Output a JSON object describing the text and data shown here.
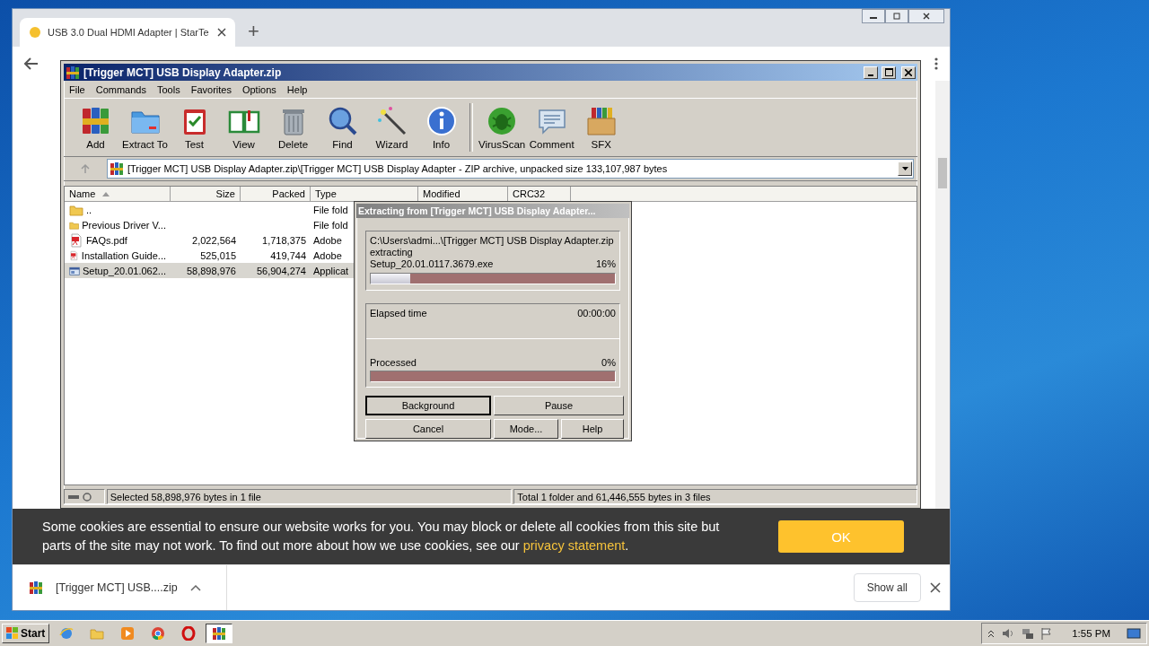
{
  "browser": {
    "tabs": [
      {
        "title": "USB 3.0 Dual HDMI Adapter | StarTe",
        "selected": true
      }
    ],
    "new_tab": "+",
    "cookie_banner": {
      "text": "Some cookies are essential to ensure our website works for you. You may block or delete all cookies from this site but parts of the site may not work. To find out more about how we use cookies, see our ",
      "link": "privacy statement",
      "end": ".",
      "button": "OK"
    },
    "download_shelf": {
      "file": "[Trigger MCT] USB....zip",
      "show_all": "Show all"
    }
  },
  "winrar": {
    "title": "[Trigger MCT] USB Display Adapter.zip",
    "menu": [
      "File",
      "Commands",
      "Tools",
      "Favorites",
      "Options",
      "Help"
    ],
    "toolbar_groups": [
      {
        "buttons": [
          "Add",
          "Extract To",
          "Test",
          "View",
          "Delete",
          "Find",
          "Wizard",
          "Info"
        ]
      },
      {
        "buttons": [
          "VirusScan",
          "Comment",
          "SFX"
        ]
      }
    ],
    "path": "[Trigger MCT] USB Display Adapter.zip\\[Trigger MCT] USB Display Adapter - ZIP archive, unpacked size 133,107,987 bytes",
    "columns": [
      "Name",
      "Size",
      "Packed",
      "Type",
      "Modified",
      "CRC32"
    ],
    "rows": [
      {
        "kind": "parent",
        "name": "..",
        "size": "",
        "packed": "",
        "type": "File fold",
        "selected": false
      },
      {
        "kind": "folder",
        "name": "Previous Driver V...",
        "size": "",
        "packed": "",
        "type": "File fold",
        "selected": false
      },
      {
        "kind": "pdf",
        "name": "FAQs.pdf",
        "size": "2,022,564",
        "packed": "1,718,375",
        "type": "Adobe",
        "selected": false
      },
      {
        "kind": "pdf",
        "name": "Installation Guide...",
        "size": "525,015",
        "packed": "419,744",
        "type": "Adobe",
        "selected": false
      },
      {
        "kind": "exe",
        "name": "Setup_20.01.062...",
        "size": "58,898,976",
        "packed": "56,904,274",
        "type": "Applicat",
        "selected": true
      }
    ],
    "status_left": "Selected 58,898,976 bytes in 1 file",
    "status_right": "Total 1 folder and 61,446,555 bytes in 3 files"
  },
  "dialog": {
    "title": "Extracting from [Trigger MCT] USB Display Adapter...",
    "archive": "C:\\Users\\admi...\\[Trigger MCT] USB Display Adapter.zip",
    "action": "extracting",
    "file": "Setup_20.01.0117.3679.exe",
    "file_percent": "16%",
    "file_progress": {
      "level": 0.16
    },
    "elapsed_label": "Elapsed time",
    "elapsed": "00:00:00",
    "processed_label": "Processed",
    "processed_percent": "0%",
    "processed_progress": {
      "level": 0
    },
    "buttons": [
      {
        "label": "Background",
        "default": true
      },
      {
        "label": "Pause",
        "default": false
      },
      {
        "label": "Cancel",
        "default": false
      },
      {
        "label": "Mode...",
        "default": false
      },
      {
        "label": "Help",
        "default": false
      }
    ]
  },
  "taskbar": {
    "start": "Start",
    "apps": [
      {
        "selected": false
      },
      {
        "selected": false
      },
      {
        "selected": false
      },
      {
        "selected": false
      },
      {
        "selected": false
      },
      {
        "selected": true
      }
    ],
    "clock": "1:55 PM"
  }
}
